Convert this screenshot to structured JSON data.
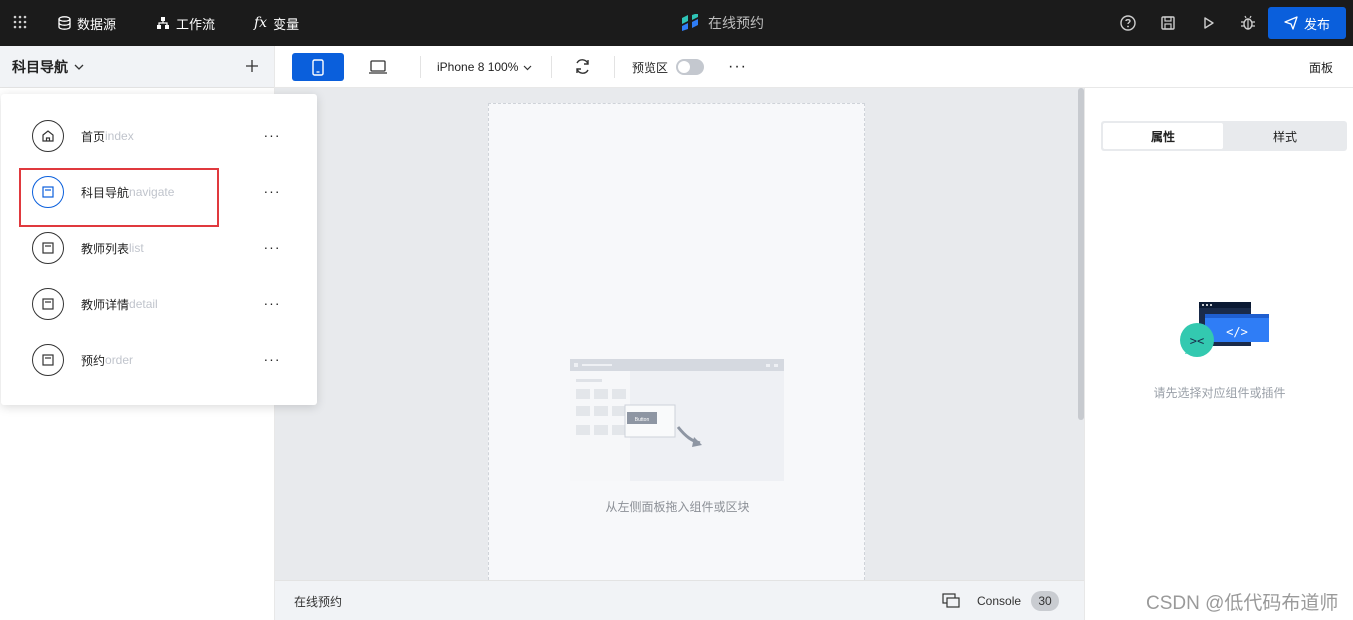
{
  "topbar": {
    "nav": [
      {
        "label": "数据源",
        "icon": "database-icon"
      },
      {
        "label": "工作流",
        "icon": "workflow-icon"
      },
      {
        "label": "变量",
        "icon": "fx-icon"
      }
    ],
    "app_title": "在线预约",
    "publish_label": "发布",
    "accent": "#0a5fdc"
  },
  "toolbar": {
    "device_label": "iPhone 8 100%",
    "preview_label": "预览区",
    "preview_enabled": false,
    "panel_label": "面板"
  },
  "left": {
    "current_page": "科目导航",
    "pages": [
      {
        "name": "首页",
        "route": "index",
        "icon": "home-icon"
      },
      {
        "name": "科目导航",
        "route": "navigate",
        "icon": "page-icon",
        "active": true
      },
      {
        "name": "教师列表",
        "route": "list",
        "icon": "page-icon"
      },
      {
        "name": "教师详情",
        "route": "detail",
        "icon": "page-icon"
      },
      {
        "name": "预约",
        "route": "order",
        "icon": "page-icon"
      }
    ]
  },
  "canvas": {
    "empty_text": "从左侧面板拖入组件或区块",
    "placeholder_button": "Button"
  },
  "status": {
    "app_name": "在线预约",
    "console_label": "Console",
    "console_count": "30"
  },
  "right": {
    "tabs": [
      "属性",
      "样式"
    ],
    "hint": "请先选择对应组件或插件"
  },
  "watermark": "CSDN @低代码布道师"
}
